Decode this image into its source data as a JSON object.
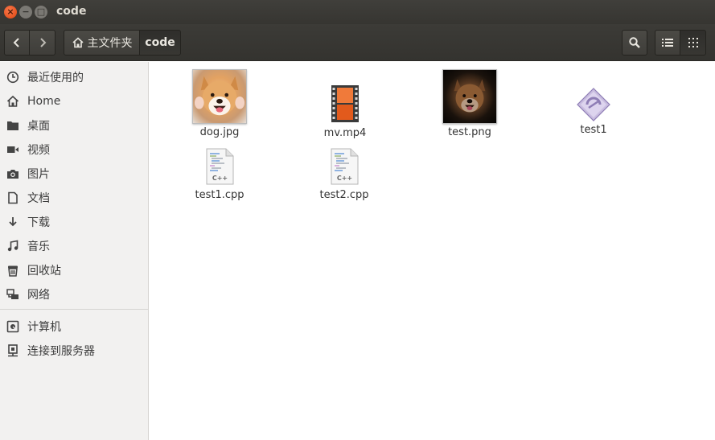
{
  "window": {
    "title": "code"
  },
  "toolbar": {
    "breadcrumb_home": "主文件夹",
    "breadcrumb_current": "code"
  },
  "sidebar": {
    "items": [
      {
        "label": "最近使用的",
        "icon": "clock-icon"
      },
      {
        "label": "Home",
        "icon": "home-icon"
      },
      {
        "label": "桌面",
        "icon": "folder-icon"
      },
      {
        "label": "视频",
        "icon": "video-icon"
      },
      {
        "label": "图片",
        "icon": "camera-icon"
      },
      {
        "label": "文档",
        "icon": "document-icon"
      },
      {
        "label": "下载",
        "icon": "download-icon"
      },
      {
        "label": "音乐",
        "icon": "music-icon"
      },
      {
        "label": "回收站",
        "icon": "trash-icon"
      },
      {
        "label": "网络",
        "icon": "network-icon"
      }
    ],
    "devices": [
      {
        "label": "计算机",
        "icon": "computer-icon"
      },
      {
        "label": "连接到服务器",
        "icon": "server-icon"
      }
    ]
  },
  "files": [
    {
      "name": "dog.jpg",
      "icon": "image-thumbnail"
    },
    {
      "name": "mv.mp4",
      "icon": "video-file-icon"
    },
    {
      "name": "test.png",
      "icon": "image-thumbnail"
    },
    {
      "name": "test1",
      "icon": "executable-icon"
    },
    {
      "name": "test1.cpp",
      "icon": "cpp-file-icon",
      "badge": "C++"
    },
    {
      "name": "test2.cpp",
      "icon": "cpp-file-icon",
      "badge": "C++"
    }
  ],
  "colors": {
    "titlebar": "#3c3b37",
    "close_button": "#f0541e",
    "sidebar": "#f2f1f0"
  }
}
